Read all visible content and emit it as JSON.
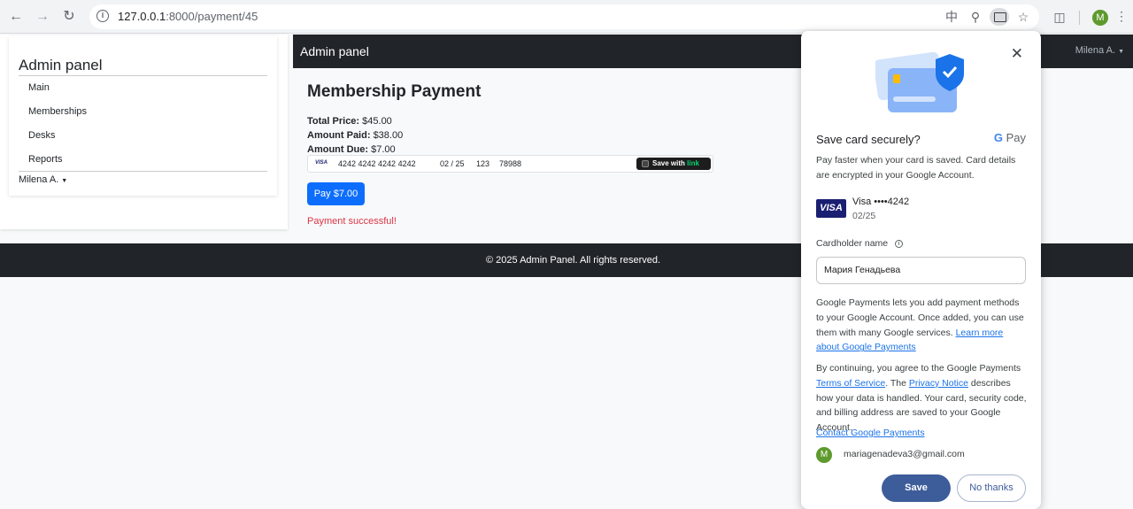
{
  "browser": {
    "url_host": "127.0.0.1",
    "url_rest": ":8000/payment/45",
    "profile_initial": "M"
  },
  "sidebar": {
    "title": "Admin panel",
    "items": [
      {
        "label": "Main"
      },
      {
        "label": "Memberships"
      },
      {
        "label": "Desks"
      },
      {
        "label": "Reports"
      }
    ],
    "user": "Milena A."
  },
  "topbar": {
    "brand": "Admin panel",
    "user": "Milena A."
  },
  "main": {
    "title": "Membership Payment",
    "total_label": "Total Price:",
    "total_value": "$45.00",
    "paid_label": "Amount Paid:",
    "paid_value": "$38.00",
    "due_label": "Amount Due:",
    "due_value": "$7.00",
    "card": {
      "brand": "VISA",
      "number": "4242 4242 4242 4242",
      "expiry": "02 / 25",
      "cvc": "123",
      "zip": "78988",
      "link_save": "Save with",
      "link_brand": "link"
    },
    "pay_button": "Pay $7.00",
    "status": "Payment successful!"
  },
  "footer": {
    "text": "© 2025 Admin Panel. All rights reserved."
  },
  "gpay_dialog": {
    "title": "Save card securely?",
    "logo_g": "G",
    "logo_pay": "Pay",
    "intro": "Pay faster when your card is saved. Card details are encrypted in your Google Account.",
    "card_brand_badge": "VISA",
    "card_label": "Visa  ••••4242",
    "card_expiry": "02/25",
    "cardholder_label": "Cardholder name",
    "cardholder_value": "Мария Генадьева",
    "para1": "Google Payments lets you add payment methods to your Google Account. Once added, you can use them with many Google services. ",
    "para1_link": "Learn more about Google Payments",
    "para2_a": "By continuing, you agree to the Google Payments ",
    "para2_tos": "Terms of Service",
    "para2_b": ". The ",
    "para2_privacy": "Privacy Notice",
    "para2_c": " describes how your data is handled. Your card, security code, and billing address are saved to your Google Account.",
    "contact_link": "Contact Google Payments",
    "account_initial": "M",
    "account_email": "mariagenadeva3@gmail.com",
    "save_button": "Save",
    "decline_button": "No thanks"
  }
}
